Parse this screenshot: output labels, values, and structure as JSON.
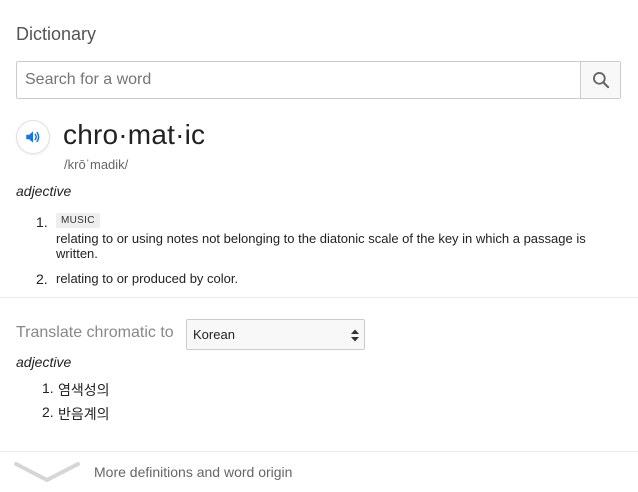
{
  "dictionary": {
    "title": "Dictionary",
    "search": {
      "placeholder": "Search for a word",
      "value": ""
    },
    "entry": {
      "headword": "chro·mat·ic",
      "phonetic": "/krōˈmadik/",
      "part_of_speech": "adjective",
      "definitions": [
        {
          "number": "1.",
          "tag": "MUSIC",
          "text": "relating to or using notes not belonging to the diatonic scale of the key in which a passage is",
          "text_cont": "written."
        },
        {
          "number": "2.",
          "text": "relating to or produced by color."
        }
      ]
    },
    "translate": {
      "label": "Translate chromatic to",
      "selected_language": "Korean",
      "part_of_speech": "adjective",
      "items": [
        {
          "number": "1.",
          "text": "염색성의"
        },
        {
          "number": "2.",
          "text": "반음계의"
        }
      ]
    },
    "more_link": "More definitions and word origin"
  },
  "colors": {
    "accent": "#1a73e8",
    "divider": "#ebebeb"
  },
  "icons": {
    "search": "search-icon",
    "speaker": "speaker-icon",
    "select_arrows": "select-arrows-icon",
    "expand": "chevron-down-icon"
  }
}
